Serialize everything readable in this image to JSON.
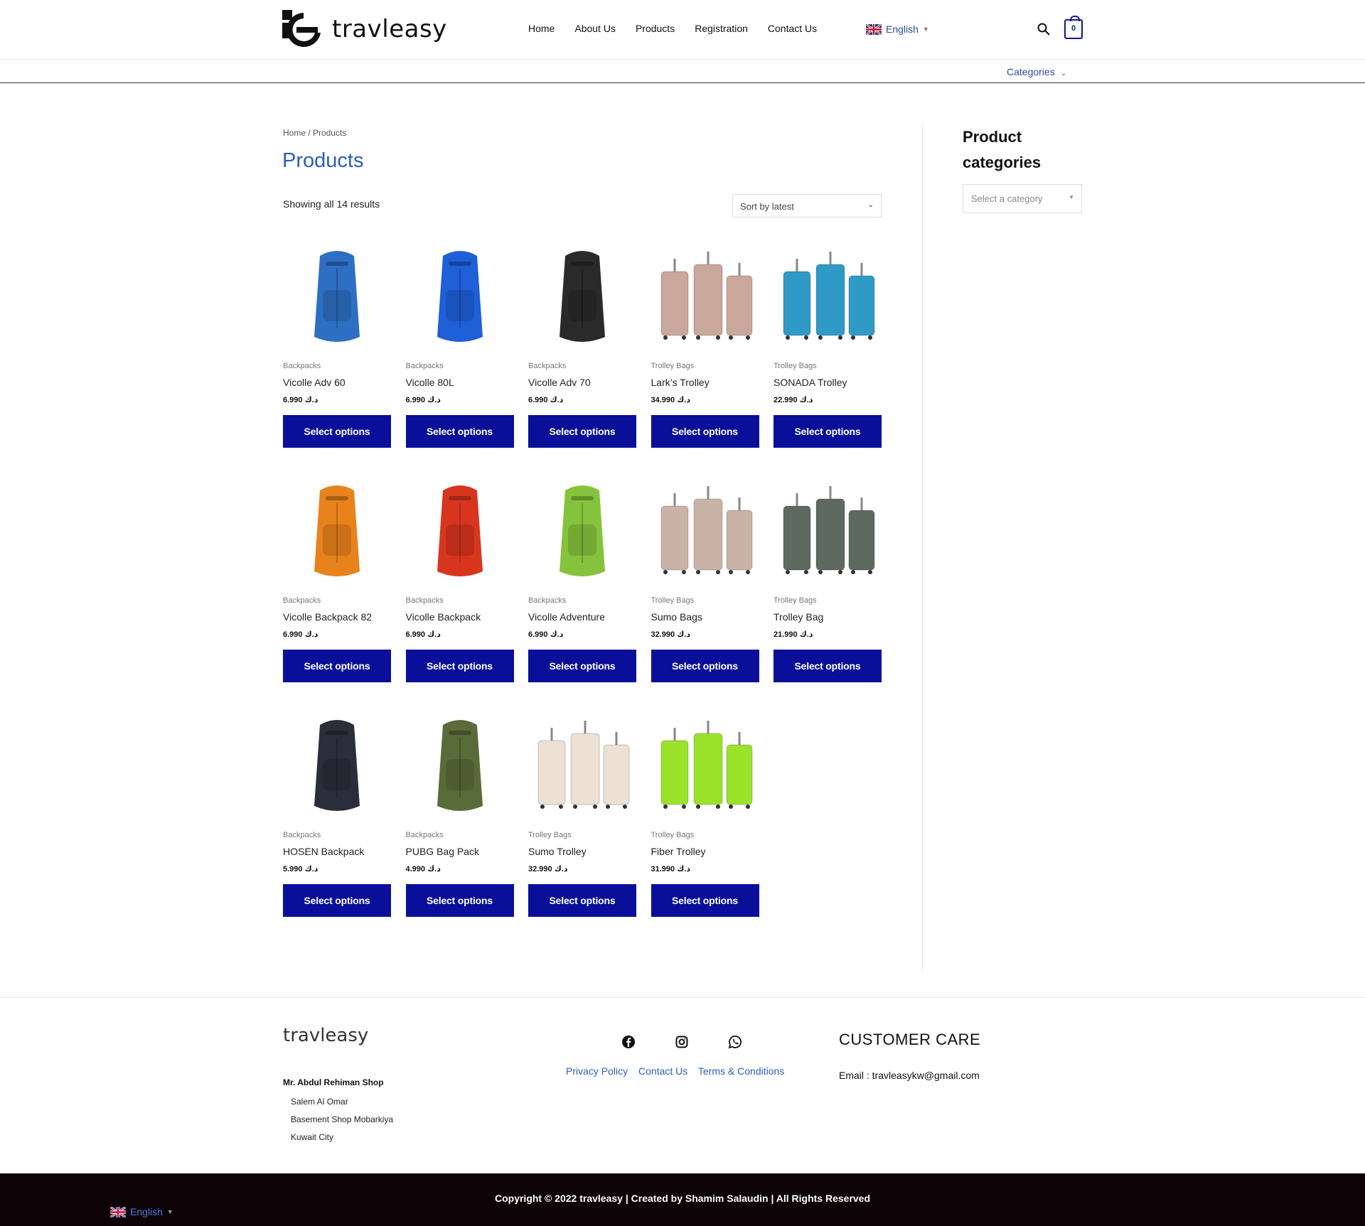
{
  "header": {
    "logo_text": "travleasy",
    "nav": [
      "Home",
      "About Us",
      "Products",
      "Registration",
      "Contact Us"
    ],
    "language": "English",
    "cart_count": "0",
    "categories_label": "Categories"
  },
  "breadcrumb": "Home / Products",
  "page_title": "Products",
  "result_count": "Showing all 14 results",
  "sort": {
    "selected": "Sort by latest"
  },
  "products": [
    {
      "category": "Backpacks",
      "name": "Vicolle Adv 60",
      "price": "6.990 د.ك",
      "button": "Select options",
      "color": "#2d6fc2"
    },
    {
      "category": "Backpacks",
      "name": "Vicolle 80L",
      "price": "6.990 د.ك",
      "button": "Select options",
      "color": "#1f5fd8"
    },
    {
      "category": "Backpacks",
      "name": "Vicolle Adv 70",
      "price": "6.990 د.ك",
      "button": "Select options",
      "color": "#2a2a2a"
    },
    {
      "category": "Trolley Bags",
      "name": "Lark’s Trolley",
      "price": "34.990 د.ك",
      "button": "Select options",
      "color": "#c9a79b"
    },
    {
      "category": "Trolley Bags",
      "name": "SONADA Trolley",
      "price": "22.990 د.ك",
      "button": "Select options",
      "color": "#2f9ac6"
    },
    {
      "category": "Backpacks",
      "name": "Vicolle Backpack 82",
      "price": "6.990 د.ك",
      "button": "Select options",
      "color": "#e8821c"
    },
    {
      "category": "Backpacks",
      "name": "Vicolle Backpack",
      "price": "6.990 د.ك",
      "button": "Select options",
      "color": "#d8351f"
    },
    {
      "category": "Backpacks",
      "name": "Vicolle Adventure",
      "price": "6.990 د.ك",
      "button": "Select options",
      "color": "#86c33c"
    },
    {
      "category": "Trolley Bags",
      "name": "Sumo Bags",
      "price": "32.990 د.ك",
      "button": "Select options",
      "color": "#c9b3a6"
    },
    {
      "category": "Trolley Bags",
      "name": "Trolley Bag",
      "price": "21.990 د.ك",
      "button": "Select options",
      "color": "#5e6a5f"
    },
    {
      "category": "Backpacks",
      "name": "HOSEN Backpack",
      "price": "5.990 د.ك",
      "button": "Select options",
      "color": "#2a2d3a"
    },
    {
      "category": "Backpacks",
      "name": "PUBG Bag Pack",
      "price": "4.990 د.ك",
      "button": "Select options",
      "color": "#5a6b3a"
    },
    {
      "category": "Trolley Bags",
      "name": "Sumo Trolley",
      "price": "32.990 د.ك",
      "button": "Select options",
      "color": "#ece1d4"
    },
    {
      "category": "Trolley Bags",
      "name": "Fiber Trolley",
      "price": "31.990 د.ك",
      "button": "Select options",
      "color": "#9be22b"
    }
  ],
  "sidebar": {
    "title": "Product categories",
    "select_placeholder": "Select a category"
  },
  "footer": {
    "logo_text": "travleasy",
    "shop_name": "Mr. Abdul Rehiman Shop",
    "address": [
      "Salem Al Omar",
      "Basement Shop Mobarkiya",
      "Kuwait City"
    ],
    "links": [
      "Privacy Policy",
      "Contact Us",
      "Terms & Conditions"
    ],
    "care_title": "CUSTOMER CARE",
    "email": "Email : travleasykw@gmail.com",
    "copyright": "Copyright © 2022 travleasy | Created by Shamim Salaudin | All Rights Reserved",
    "language": "English"
  }
}
